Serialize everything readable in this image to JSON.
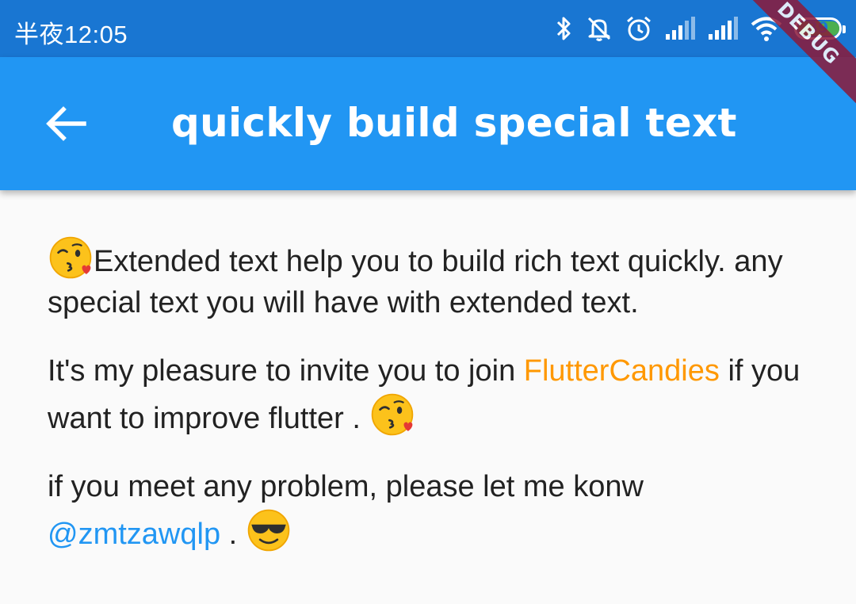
{
  "status_bar": {
    "time": "半夜12:05",
    "battery_level": "39",
    "icons": [
      "bluetooth-icon",
      "mute-icon",
      "alarm-icon",
      "signal-icon",
      "signal-icon",
      "wifi-icon",
      "battery-icon"
    ]
  },
  "debug_badge": "DEBUG",
  "app_bar": {
    "back_icon": "arrow-left-icon",
    "title": "quickly build special text"
  },
  "content": {
    "p1": {
      "emoji": "kissing-heart-emoji",
      "text": "Extended text help you to build rich text quickly. any special text you will have with extended text."
    },
    "p2": {
      "text_before": "It's my pleasure to invite you to join ",
      "link": "FlutterCandies",
      "text_after": " if you want to improve flutter . ",
      "emoji": "kissing-heart-emoji"
    },
    "p3": {
      "text_before": "if you meet any problem, please let me konw ",
      "mention": "@zmtzawqlp",
      "text_after": " . ",
      "emoji": "sunglasses-emoji"
    }
  },
  "colors": {
    "status_bar": "#1976d2",
    "app_bar": "#2196f3",
    "link_orange": "#ff9800",
    "link_blue": "#2196f3",
    "debug_ribbon": "#8b1a3a"
  }
}
